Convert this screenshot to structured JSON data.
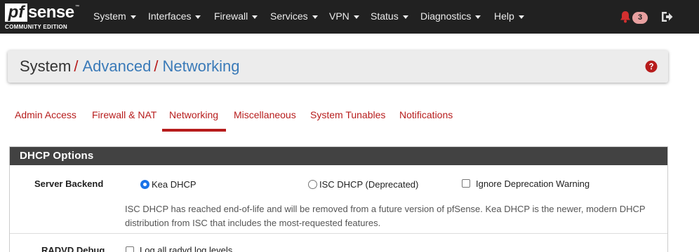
{
  "navbar": {
    "logo": {
      "pf": "pf",
      "sense": "sense",
      "edition": "COMMUNITY EDITION"
    },
    "menus": [
      {
        "label": "System"
      },
      {
        "label": "Interfaces"
      },
      {
        "label": "Firewall"
      },
      {
        "label": "Services"
      },
      {
        "label": "VPN"
      },
      {
        "label": "Status"
      },
      {
        "label": "Diagnostics"
      },
      {
        "label": "Help"
      }
    ],
    "notification_count": "3",
    "icons": {
      "notifications": "bell-icon",
      "logout": "logout-icon"
    }
  },
  "breadcrumb": {
    "root": "System",
    "sep": "/",
    "items": [
      "Advanced",
      "Networking"
    ],
    "help_icon": "question-circle-icon"
  },
  "tabs": [
    {
      "label": "Admin Access",
      "active": false
    },
    {
      "label": "Firewall & NAT",
      "active": false
    },
    {
      "label": "Networking",
      "active": true
    },
    {
      "label": "Miscellaneous",
      "active": false
    },
    {
      "label": "System Tunables",
      "active": false
    },
    {
      "label": "Notifications",
      "active": false
    }
  ],
  "panel": {
    "title": "DHCP Options",
    "server_backend": {
      "label": "Server Backend",
      "options": [
        {
          "label": "Kea DHCP",
          "checked": true
        },
        {
          "label": "ISC DHCP (Deprecated)",
          "checked": false
        }
      ],
      "ignore_warning": {
        "label": "Ignore Deprecation Warning",
        "checked": false
      },
      "help": "ISC DHCP has reached end-of-life and will be removed from a future version of pfSense. Kea DHCP is the newer, modern DHCP distribution from ISC that includes the most-requested features."
    },
    "radvd_debug": {
      "label": "RADVD Debug",
      "option": {
        "label": "Log all radvd log levels",
        "checked": false
      }
    }
  },
  "colors": {
    "navbar_bg": "#212121",
    "accent_red": "#b71c1c",
    "link_blue": "#3a7ab8",
    "panel_heading": "#424242",
    "radio_selected": "#1a73e8"
  }
}
